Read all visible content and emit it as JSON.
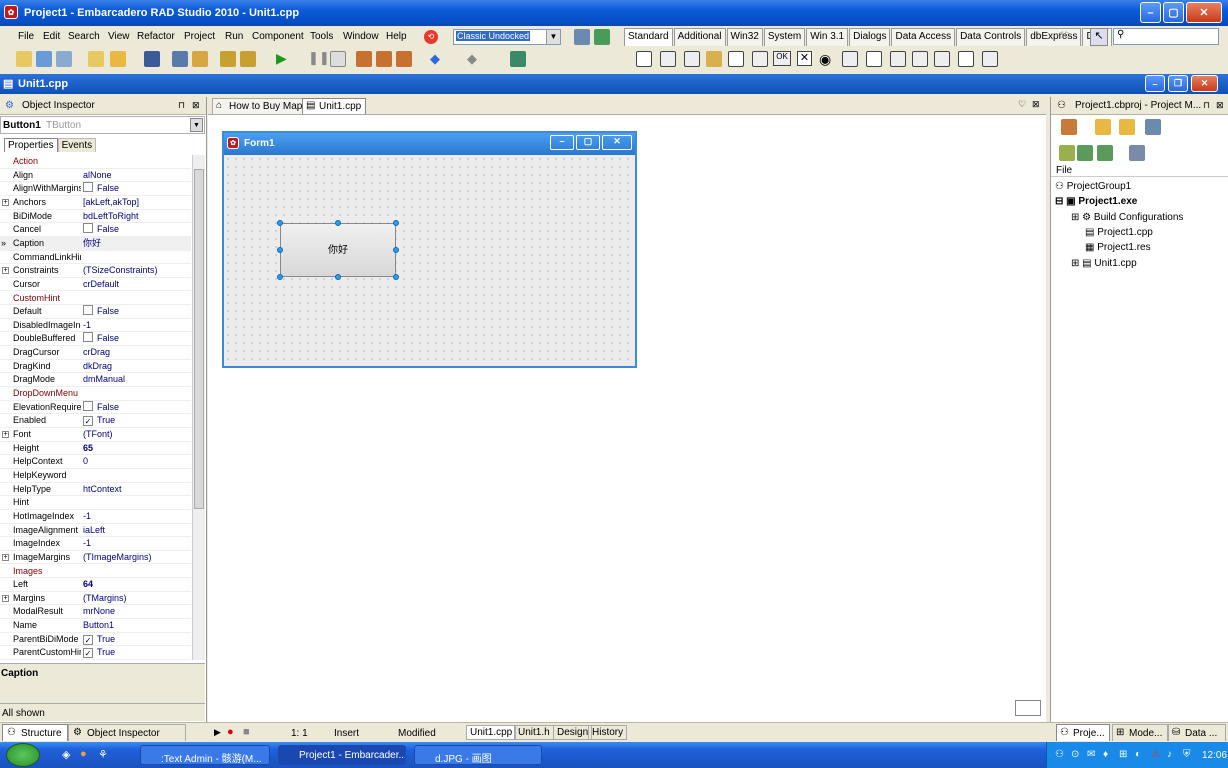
{
  "window": {
    "title": "Project1 - Embarcadero RAD Studio 2010 - Unit1.cpp"
  },
  "menu": [
    "File",
    "Edit",
    "Search",
    "View",
    "Refactor",
    "Project",
    "Run",
    "Component",
    "Tools",
    "Window",
    "Help"
  ],
  "layout_combo": {
    "value": "Classic Undocked"
  },
  "palette_tabs": [
    "Standard",
    "Additional",
    "Win32",
    "System",
    "Win 3.1",
    "Dialogs",
    "Data Access",
    "Data Controls",
    "dbExpress",
    "Data"
  ],
  "editor_window": {
    "title": "Unit1.cpp"
  },
  "object_inspector": {
    "title": "Object Inspector",
    "selected_component": "Button1",
    "selected_type": "TButton",
    "tabs": [
      "Properties",
      "Events"
    ],
    "props": [
      {
        "n": "Action",
        "v": "",
        "evt": true
      },
      {
        "n": "Align",
        "v": "alNone"
      },
      {
        "n": "AlignWithMargins",
        "v": "False",
        "cb": ""
      },
      {
        "n": "Anchors",
        "v": "[akLeft,akTop]",
        "plus": "+"
      },
      {
        "n": "BiDiMode",
        "v": "bdLeftToRight"
      },
      {
        "n": "Cancel",
        "v": "False",
        "cb": ""
      },
      {
        "n": "Caption",
        "v": "你好",
        "sel": true
      },
      {
        "n": "CommandLinkHint",
        "v": ""
      },
      {
        "n": "Constraints",
        "v": "(TSizeConstraints)",
        "plus": "+"
      },
      {
        "n": "Cursor",
        "v": "crDefault"
      },
      {
        "n": "CustomHint",
        "v": "",
        "evt": true
      },
      {
        "n": "Default",
        "v": "False",
        "cb": ""
      },
      {
        "n": "DisabledImageIndex",
        "v": "-1"
      },
      {
        "n": "DoubleBuffered",
        "v": "False",
        "cb": ""
      },
      {
        "n": "DragCursor",
        "v": "crDrag"
      },
      {
        "n": "DragKind",
        "v": "dkDrag"
      },
      {
        "n": "DragMode",
        "v": "dmManual"
      },
      {
        "n": "DropDownMenu",
        "v": "",
        "evt": true
      },
      {
        "n": "ElevationRequired",
        "v": "False",
        "cb": ""
      },
      {
        "n": "Enabled",
        "v": "True",
        "cb": "✓"
      },
      {
        "n": "Font",
        "v": "(TFont)",
        "plus": "+"
      },
      {
        "n": "Height",
        "v": "65",
        "bold": true
      },
      {
        "n": "HelpContext",
        "v": "0"
      },
      {
        "n": "HelpKeyword",
        "v": ""
      },
      {
        "n": "HelpType",
        "v": "htContext"
      },
      {
        "n": "Hint",
        "v": ""
      },
      {
        "n": "HotImageIndex",
        "v": "-1"
      },
      {
        "n": "ImageAlignment",
        "v": "iaLeft"
      },
      {
        "n": "ImageIndex",
        "v": "-1"
      },
      {
        "n": "ImageMargins",
        "v": "(TImageMargins)",
        "plus": "+"
      },
      {
        "n": "Images",
        "v": "",
        "evt": true
      },
      {
        "n": "Left",
        "v": "64",
        "bold": true
      },
      {
        "n": "Margins",
        "v": "(TMargins)",
        "plus": "+"
      },
      {
        "n": "ModalResult",
        "v": "mrNone"
      },
      {
        "n": "Name",
        "v": "Button1"
      },
      {
        "n": "ParentBiDiMode",
        "v": "True",
        "cb": "✓"
      },
      {
        "n": "ParentCustomHint",
        "v": "True",
        "cb": "✓"
      }
    ],
    "desc_title": "Caption",
    "status": "All shown"
  },
  "editor_tabs": [
    "How to Buy Map",
    "Unit1.cpp"
  ],
  "form": {
    "title": "Form1",
    "button_caption": "你好"
  },
  "project_manager": {
    "title": "Project1.cbproj - Project M...",
    "file_header": "File",
    "tree": [
      "ProjectGroup1",
      "Project1.exe",
      "Build Configurations",
      "Project1.cpp",
      "Project1.res",
      "Unit1.cpp"
    ]
  },
  "statusbar": {
    "position": "1:  1",
    "mode": "Insert",
    "modified": "Modified",
    "tabs": [
      "Unit1.cpp",
      "Unit1.h",
      "Design",
      "History"
    ]
  },
  "bottom_tabs_left": [
    "Structure",
    "Object Inspector"
  ],
  "bottom_tabs_right": [
    "Proje...",
    "Mode...",
    "Data ..."
  ],
  "taskbar": {
    "tasks": [
      ":Text Admin - 骸游(M...",
      "Project1 - Embarcader...",
      "d.JPG - 画图"
    ],
    "clock": "12:06"
  }
}
